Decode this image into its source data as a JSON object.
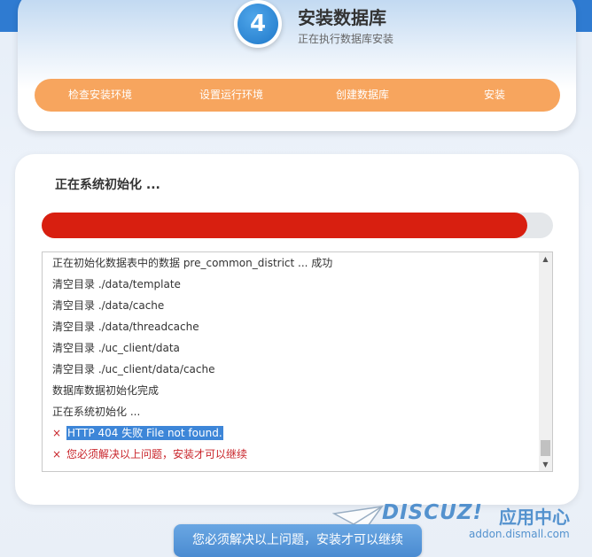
{
  "header": {
    "step_number": "4",
    "title": "安装数据库",
    "subtitle": "正在执行数据库安装"
  },
  "steps": [
    {
      "label": "检查安装环境"
    },
    {
      "label": "设置运行环境"
    },
    {
      "label": "创建数据库"
    },
    {
      "label": "安装"
    }
  ],
  "main": {
    "status_title": "正在系统初始化 ...",
    "progress": 0.95,
    "progress_color": "#d81f10"
  },
  "log": {
    "lines": [
      {
        "text": "正在初始化数据表中的数据 pre_common_district ... 成功",
        "type": "info"
      },
      {
        "text": "清空目录 ./data/template",
        "type": "info"
      },
      {
        "text": "清空目录 ./data/cache",
        "type": "info"
      },
      {
        "text": "清空目录 ./data/threadcache",
        "type": "info"
      },
      {
        "text": "清空目录 ./uc_client/data",
        "type": "info"
      },
      {
        "text": "清空目录 ./uc_client/data/cache",
        "type": "info"
      },
      {
        "text": "数据库数据初始化完成",
        "type": "info"
      },
      {
        "text": "正在系统初始化 ...",
        "type": "info"
      },
      {
        "mark": "×",
        "text": "HTTP 404 失败 File not found.",
        "type": "error-selected"
      },
      {
        "mark": "×",
        "text": "您必须解决以上问题，安装才可以继续",
        "type": "error"
      }
    ]
  },
  "footer": {
    "button_label": "您必须解决以上问题，安装才可以继续"
  },
  "watermark": {
    "brand": "DISCUZ!",
    "brand_cn": "应用中心",
    "url": "addon.dismall.com"
  },
  "colors": {
    "accent_blue": "#2f7bd1",
    "steps_orange": "#f7a55e",
    "error_red": "#c9252b"
  }
}
